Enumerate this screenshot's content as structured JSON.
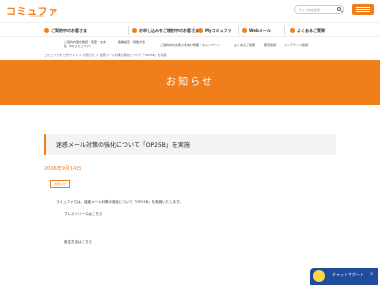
{
  "header": {
    "logo": "コミュファ",
    "logo_sub": "commufa",
    "search_placeholder": "サイト内を検索"
  },
  "nav": {
    "items": [
      {
        "label": "ご契約中のお客さま"
      },
      {
        "label": "お申し込みをご検討中のお客さま"
      },
      {
        "label": "Myコミュファ"
      },
      {
        "label": "Webメール"
      },
      {
        "label": "よくあるご質問"
      }
    ]
  },
  "subnav": {
    "items": [
      "ご契約内容の確認・変更・お支払（Myコミュファ）",
      "各種設定・施策方法",
      "ご契約中のお客さま向け特典・キャンペーン",
      "よくあるご質問",
      "障害情報",
      "メンテナンス情報"
    ]
  },
  "breadcrumb": "コミュファ光 公式サイト ＞ お知らせ ＞ 迷惑メール対策の強化について「OP25B」を実施",
  "banner": {
    "title": "お知らせ"
  },
  "article": {
    "title": "迷惑メール対策の強化について「OP25B」を実施",
    "date": "2006年9月14日",
    "tag": "お知らせ",
    "paragraphs": [
      "コミュファでは、迷惑メール対策の強化について「OP25B」を実施いたします。",
      "プレスリリースはこちら",
      "設定方法はこちら"
    ]
  },
  "chat": {
    "label": "チャットサポート",
    "close": "×"
  },
  "colors": {
    "accent": "#f07f1b",
    "chat": "#1f4c9b"
  }
}
